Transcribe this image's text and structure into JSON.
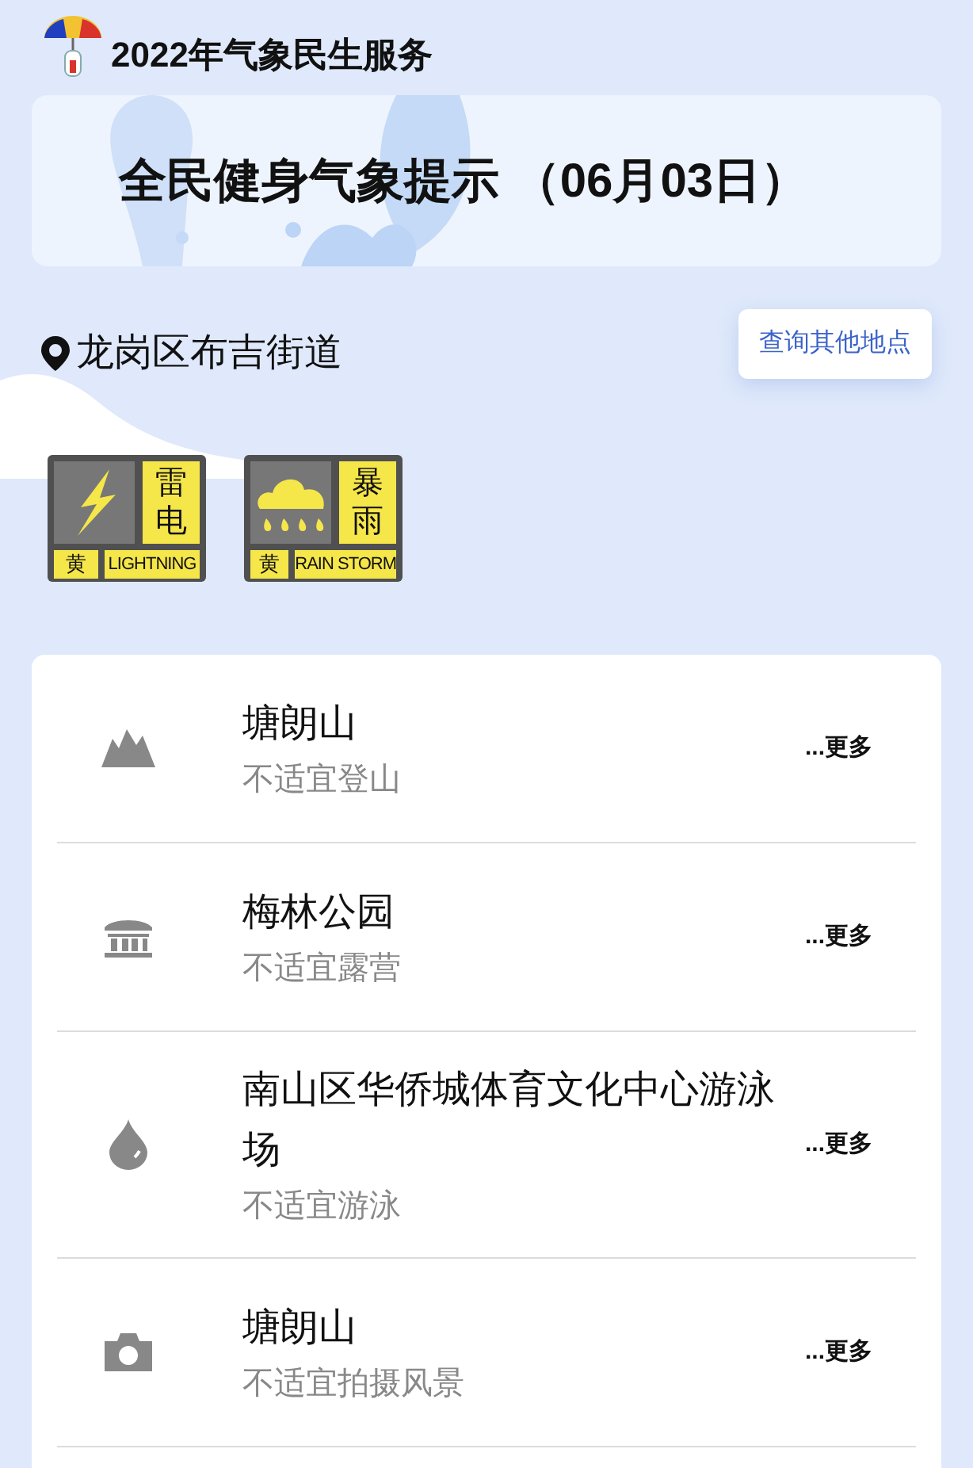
{
  "header": {
    "title": "2022年气象民生服务"
  },
  "banner": {
    "title": "全民健身气象提示",
    "date": "（06月03日）"
  },
  "location": {
    "name": "龙岗区布吉街道",
    "button": "查询其他地点"
  },
  "warnings": [
    {
      "kind": "lightning",
      "name": "雷电",
      "level": "黄",
      "english": "LIGHTNING"
    },
    {
      "kind": "rainstorm",
      "name": "暴雨",
      "level": "黄",
      "english": "RAIN STORM"
    }
  ],
  "places": [
    {
      "kind": "mountain",
      "name": "塘朗山",
      "advice": "不适宜登山",
      "more": "...更多"
    },
    {
      "kind": "building",
      "name": "梅林公园",
      "advice": "不适宜露营",
      "more": "...更多"
    },
    {
      "kind": "drop",
      "name": "南山区华侨城体育文化中心游泳场",
      "advice": "不适宜游泳",
      "more": "...更多"
    },
    {
      "kind": "camera",
      "name": "塘朗山",
      "advice": "不适宜拍摄风景",
      "more": "...更多"
    }
  ]
}
